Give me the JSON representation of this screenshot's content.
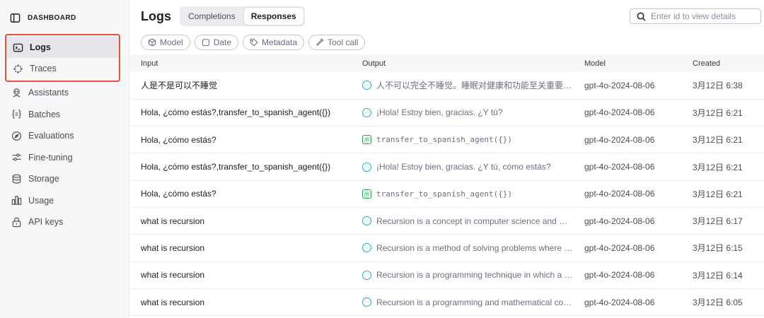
{
  "sidebar": {
    "header": {
      "label": "DASHBOARD",
      "icon": "sidebar-toggle-icon"
    },
    "highlighted": [
      {
        "label": "Logs",
        "icon": "terminal-icon",
        "active": true
      },
      {
        "label": "Traces",
        "icon": "traces-icon",
        "active": false
      }
    ],
    "items": [
      {
        "label": "Assistants",
        "icon": "assistant-icon"
      },
      {
        "label": "Batches",
        "icon": "braces-icon"
      },
      {
        "label": "Evaluations",
        "icon": "compass-icon"
      },
      {
        "label": "Fine-tuning",
        "icon": "sliders-icon"
      },
      {
        "label": "Storage",
        "icon": "database-icon"
      },
      {
        "label": "Usage",
        "icon": "bar-chart-icon"
      },
      {
        "label": "API keys",
        "icon": "lock-icon"
      }
    ]
  },
  "header": {
    "title": "Logs",
    "tabs": [
      {
        "label": "Completions",
        "active": false
      },
      {
        "label": "Responses",
        "active": true
      }
    ],
    "search": {
      "placeholder": "Enter id to view details"
    }
  },
  "filters": [
    {
      "label": "Model",
      "icon": "cube-icon"
    },
    {
      "label": "Date",
      "icon": "calendar-icon"
    },
    {
      "label": "Metadata",
      "icon": "tag-icon"
    },
    {
      "label": "Tool call",
      "icon": "wrench-icon"
    }
  ],
  "table": {
    "columns": {
      "input": "Input",
      "output": "Output",
      "model": "Model",
      "created": "Created"
    },
    "rows": [
      {
        "input": "人是不是可以不睡觉",
        "output": "人不可以完全不睡觉。睡眠对健康和功能至关重要。...",
        "output_type": "message",
        "model": "gpt-4o-2024-08-06",
        "created": "3月12日 6:38"
      },
      {
        "input": "Hola, ¿cómo estás?,transfer_to_spanish_agent({})",
        "output": "¡Hola! Estoy bien, gracias. ¿Y tú?",
        "output_type": "message",
        "model": "gpt-4o-2024-08-06",
        "created": "3月12日 6:21"
      },
      {
        "input": "Hola, ¿cómo estás?",
        "output": "transfer_to_spanish_agent({})",
        "output_type": "function",
        "model": "gpt-4o-2024-08-06",
        "created": "3月12日 6:21"
      },
      {
        "input": "Hola, ¿cómo estás?,transfer_to_spanish_agent({})",
        "output": "¡Hola! Estoy bien, gracias. ¿Y tú, cómo estás?",
        "output_type": "message",
        "model": "gpt-4o-2024-08-06",
        "created": "3月12日 6:21"
      },
      {
        "input": "Hola, ¿cómo estás?",
        "output": "transfer_to_spanish_agent({})",
        "output_type": "function",
        "model": "gpt-4o-2024-08-06",
        "created": "3月12日 6:21"
      },
      {
        "input": "what is recursion",
        "output": "Recursion is a concept in computer science and ma...",
        "output_type": "message",
        "model": "gpt-4o-2024-08-06",
        "created": "3月12日 6:17"
      },
      {
        "input": "what is recursion",
        "output": "Recursion is a method of solving problems where a ...",
        "output_type": "message",
        "model": "gpt-4o-2024-08-06",
        "created": "3月12日 6:15"
      },
      {
        "input": "what is recursion",
        "output": "Recursion is a programming technique in which a f...",
        "output_type": "message",
        "model": "gpt-4o-2024-08-06",
        "created": "3月12日 6:14"
      },
      {
        "input": "what is recursion",
        "output": "Recursion is a programming and mathematical con...",
        "output_type": "message",
        "model": "gpt-4o-2024-08-06",
        "created": "3月12日 6:05"
      }
    ]
  },
  "colors": {
    "highlight_border": "#e5533d",
    "message_badge": "#2aa6c8",
    "function_badge": "#16a34a"
  }
}
